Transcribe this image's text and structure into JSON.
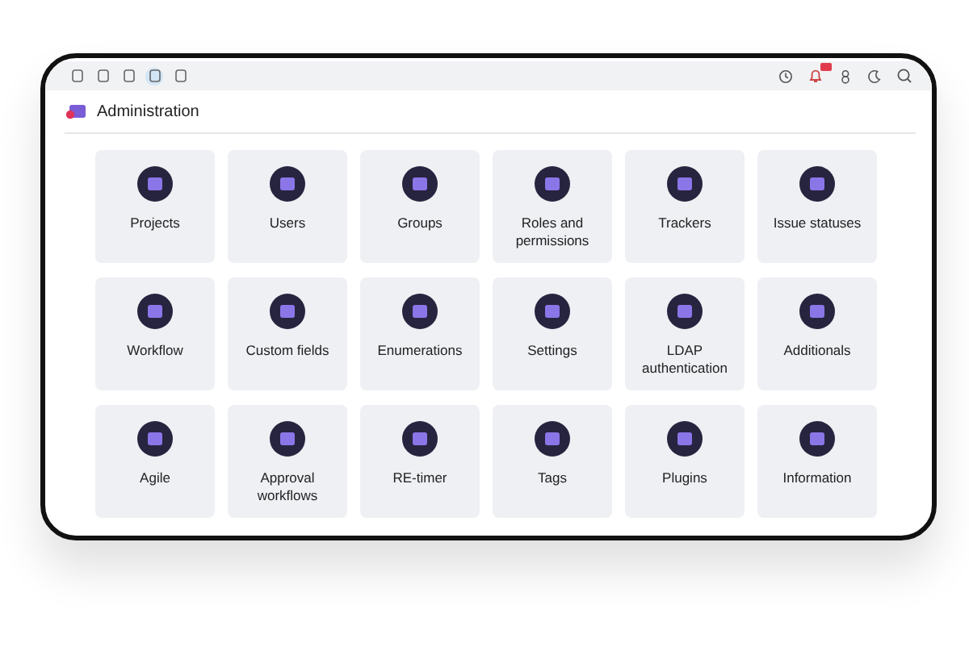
{
  "toolbar": {
    "left_icons": [
      {
        "selected": false
      },
      {
        "selected": false
      },
      {
        "selected": false
      },
      {
        "selected": true
      },
      {
        "selected": false
      }
    ],
    "notifications": {
      "unread": true
    }
  },
  "page": {
    "title": "Administration"
  },
  "tiles": [
    {
      "label": "Projects"
    },
    {
      "label": "Users"
    },
    {
      "label": "Groups"
    },
    {
      "label": "Roles and permissions"
    },
    {
      "label": "Trackers"
    },
    {
      "label": "Issue statuses"
    },
    {
      "label": "Workflow"
    },
    {
      "label": "Custom fields"
    },
    {
      "label": "Enumerations"
    },
    {
      "label": "Settings"
    },
    {
      "label": "LDAP authentication"
    },
    {
      "label": "Additionals"
    },
    {
      "label": "Agile"
    },
    {
      "label": "Approval workflows"
    },
    {
      "label": "RE-timer"
    },
    {
      "label": "Tags"
    },
    {
      "label": "Plugins"
    },
    {
      "label": "Information"
    }
  ]
}
